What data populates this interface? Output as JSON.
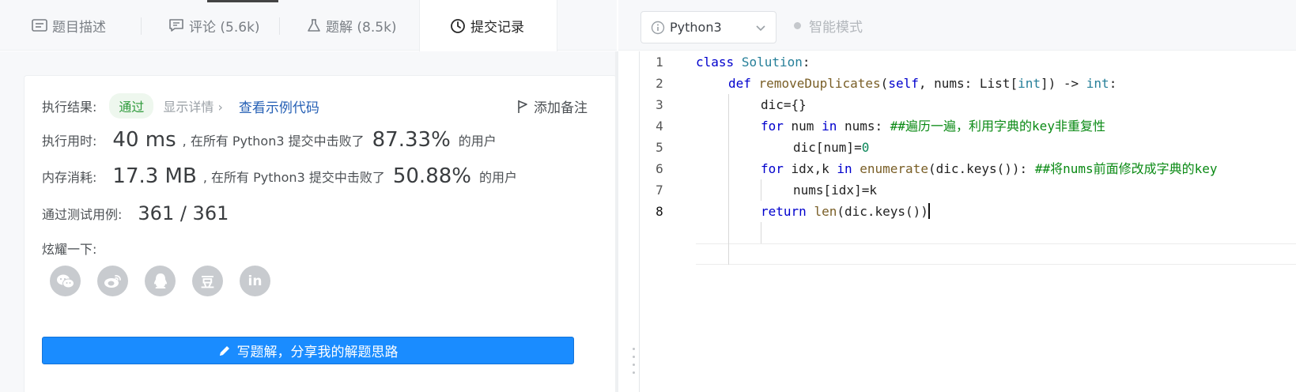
{
  "tabs": [
    {
      "label": "题目描述",
      "icon": "description-icon"
    },
    {
      "label": "评论 (5.6k)",
      "icon": "comment-icon"
    },
    {
      "label": "题解 (8.5k)",
      "icon": "flask-icon"
    },
    {
      "label": "提交记录",
      "icon": "clock-icon",
      "active": true
    }
  ],
  "toolbar": {
    "language": "Python3",
    "smart_mode": "智能模式"
  },
  "result": {
    "label": "执行结果:",
    "status": "通过",
    "details": "显示详情 ›",
    "example_link": "查看示例代码",
    "add_note": "添加备注"
  },
  "runtime": {
    "label": "执行用时:",
    "value": "40 ms",
    "mid_text": ", 在所有 Python3 提交中击败了",
    "percent": "87.33%",
    "suffix": "的用户"
  },
  "memory": {
    "label": "内存消耗:",
    "value": "17.3 MB",
    "mid_text": ", 在所有 Python3 提交中击败了",
    "percent": "50.88%",
    "suffix": "的用户"
  },
  "tests": {
    "label": "通过测试用例:",
    "value": "361 / 361"
  },
  "share": {
    "label": "炫耀一下:",
    "icons": [
      "wechat-icon",
      "weibo-icon",
      "qq-icon",
      "douban-icon",
      "linkedin-icon"
    ],
    "douban_char": "豆",
    "linkedin_text": "in"
  },
  "write_button": "写题解，分享我的解题思路",
  "code": {
    "line_numbers": [
      "1",
      "2",
      "3",
      "4",
      "5",
      "6",
      "7",
      "8"
    ],
    "l1": {
      "kw": "class",
      "name": "Solution",
      "end": ":"
    },
    "l2": {
      "kw": "def",
      "fn": "removeDuplicates",
      "p1": "(",
      "self": "self",
      "p2": ", nums: List[",
      "t1": "int",
      "p3": "]) -> ",
      "t2": "int",
      "p4": ":"
    },
    "l3": {
      "text": "dic={}"
    },
    "l4": {
      "kw": "for",
      "a": " num ",
      "kw2": "in",
      "b": " nums: ",
      "comment": "##遍历一遍，利用字典的key非重复性"
    },
    "l5": {
      "a": "dic[num]=",
      "num": "0"
    },
    "l6": {
      "kw": "for",
      "a": " idx,k ",
      "kw2": "in",
      "sp": " ",
      "fn": "enumerate",
      "b": "(dic.keys()): ",
      "comment": "##将nums前面修改成字典的key"
    },
    "l7": {
      "text": "nums[idx]=k"
    },
    "l8": {
      "kw": "return",
      "sp": " ",
      "fn": "len",
      "a": "(dic.keys())"
    }
  }
}
